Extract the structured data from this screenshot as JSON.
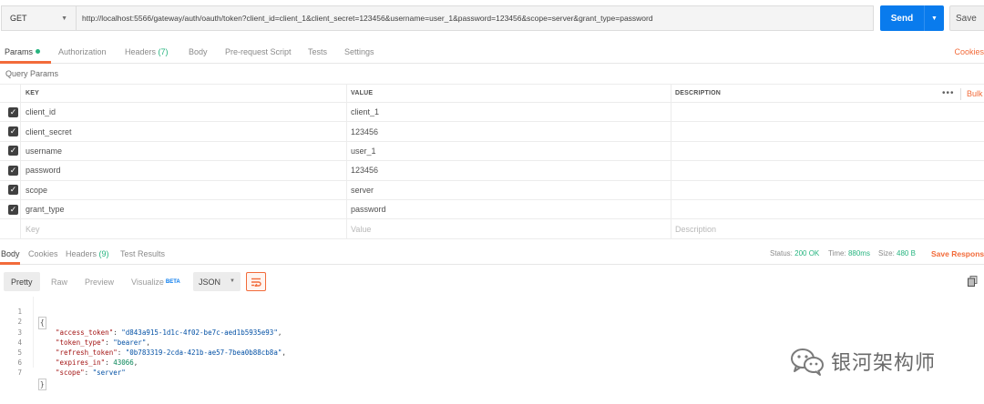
{
  "request": {
    "method": "GET",
    "url": "http://localhost:5566/gateway/auth/oauth/token?client_id=client_1&client_secret=123456&username=user_1&password=123456&scope=server&grant_type=password",
    "send_label": "Send",
    "save_label": "Save"
  },
  "request_tabs": {
    "params": "Params",
    "authorization": "Authorization",
    "headers": "Headers",
    "headers_count": "(7)",
    "body": "Body",
    "pre_request_script": "Pre-request Script",
    "tests": "Tests",
    "settings": "Settings",
    "cookies": "Cookies"
  },
  "query_params": {
    "title": "Query Params",
    "columns": {
      "key": "KEY",
      "value": "VALUE",
      "description": "DESCRIPTION"
    },
    "more": "•••",
    "bulk_edit": "Bulk",
    "rows": [
      {
        "key": "client_id",
        "value": "client_1",
        "description": ""
      },
      {
        "key": "client_secret",
        "value": "123456",
        "description": ""
      },
      {
        "key": "username",
        "value": "user_1",
        "description": ""
      },
      {
        "key": "password",
        "value": "123456",
        "description": ""
      },
      {
        "key": "scope",
        "value": "server",
        "description": ""
      },
      {
        "key": "grant_type",
        "value": "password",
        "description": ""
      }
    ],
    "placeholder": {
      "key": "Key",
      "value": "Value",
      "description": "Description"
    }
  },
  "response_tabs": {
    "body": "Body",
    "cookies": "Cookies",
    "headers": "Headers",
    "headers_count": "(9)",
    "test_results": "Test Results"
  },
  "response_status": {
    "status_label": "Status:",
    "status_value": "200 OK",
    "time_label": "Time:",
    "time_value": "880ms",
    "size_label": "Size:",
    "size_value": "480 B",
    "save_response": "Save Response"
  },
  "view_modes": {
    "pretty": "Pretty",
    "raw": "Raw",
    "preview": "Preview",
    "visualize": "Visualize",
    "beta": "BETA",
    "format": "JSON"
  },
  "response_body": {
    "line_numbers": [
      "1",
      "2",
      "3",
      "4",
      "5",
      "6",
      "7"
    ],
    "open_brace": "{",
    "close_brace": "}",
    "fields": [
      {
        "key": "\"access_token\"",
        "value": "\"d843a915-1d1c-4f02-be7c-aed1b5935e93\"",
        "kind": "string",
        "comma": ","
      },
      {
        "key": "\"token_type\"",
        "value": "\"bearer\"",
        "kind": "string",
        "comma": ","
      },
      {
        "key": "\"refresh_token\"",
        "value": "\"0b783319-2cda-421b-ae57-7bea0b88cb8a\"",
        "kind": "string",
        "comma": ","
      },
      {
        "key": "\"expires_in\"",
        "value": "43066",
        "kind": "number",
        "comma": ","
      },
      {
        "key": "\"scope\"",
        "value": "\"server\"",
        "kind": "string",
        "comma": ""
      }
    ]
  },
  "watermark": {
    "text": "银河架构师",
    "icon": "wechat-icon"
  },
  "colors": {
    "accent": "#f26b3a",
    "send": "#097bed",
    "status_ok": "#26b47f"
  }
}
